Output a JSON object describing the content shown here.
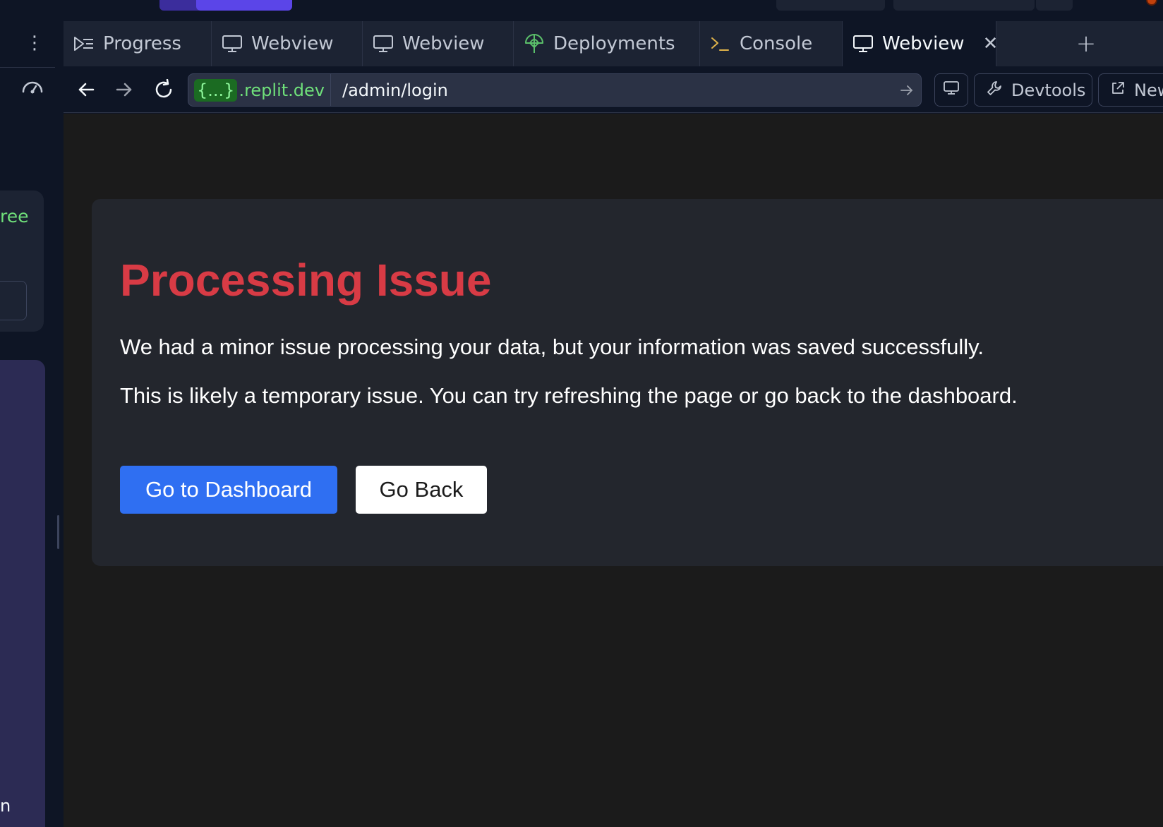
{
  "window": {
    "accent_color": "#5b45e8"
  },
  "left_panel": {
    "menu_icon": "kebab-menu-icon",
    "gauge_icon": "gauge-icon",
    "partial_text": "ree",
    "partial_text_bottom": "n"
  },
  "tabs": [
    {
      "label": "Progress",
      "icon": "progress-icon",
      "active": false
    },
    {
      "label": "Webview",
      "icon": "monitor-icon",
      "active": false
    },
    {
      "label": "Webview",
      "icon": "monitor-icon",
      "active": false
    },
    {
      "label": "Deployments",
      "icon": "deployments-icon",
      "active": false
    },
    {
      "label": "Console",
      "icon": "terminal-icon",
      "active": false
    },
    {
      "label": "Webview",
      "icon": "monitor-icon",
      "active": true,
      "closable": true
    }
  ],
  "add_tab_icon": "plus-icon",
  "browser": {
    "url_host_brace": "{...}",
    "url_host": ".replit.dev",
    "url_path": "/admin/login",
    "devtools_label": "Devtools",
    "new_tab_label": "New"
  },
  "page": {
    "title": "Processing Issue",
    "message": "We had a minor issue processing your data, but your information was saved successfully.",
    "hint": "This is likely a temporary issue. You can try refreshing the page or go back to the dashboard.",
    "primary_button": "Go to Dashboard",
    "secondary_button": "Go Back",
    "title_color": "#d83b45",
    "primary_color": "#2f6ff2"
  }
}
